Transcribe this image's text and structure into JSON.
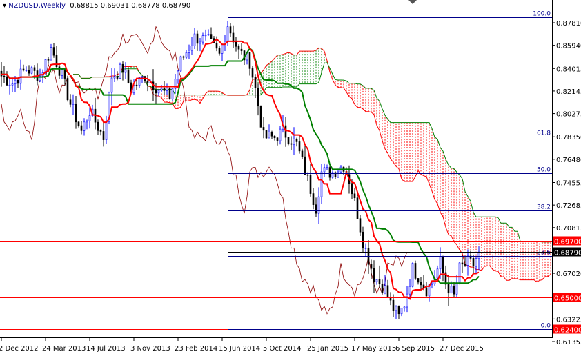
{
  "header": {
    "symbol": "NZDUSD,Weekly",
    "ohlc": "0.68815 0.69031 0.68778 0.68790"
  },
  "chart_data": {
    "type": "candlestick",
    "title": "NZDUSD,Weekly",
    "ylim": [
      0.6115,
      0.8925
    ],
    "y_ticks": [
      "0.87810",
      "0.85940",
      "0.84015",
      "0.82145",
      "0.80275",
      "0.78350",
      "0.76480",
      "0.74555",
      "0.72685",
      "0.70815",
      "0.67020",
      "0.63225",
      "0.61355"
    ],
    "x_ticks": [
      "2 Dec 2012",
      "24 Mar 2013",
      "14 Jul 2013",
      "3 Nov 2013",
      "23 Feb 2014",
      "15 Jun 2014",
      "5 Oct 2014",
      "25 Jan 2015",
      "17 May 2015",
      "6 Sep 2015",
      "27 Dec 2015"
    ],
    "x_tick_weeks": [
      0,
      16,
      32,
      48,
      64,
      80,
      96,
      112,
      128,
      144,
      160
    ],
    "close_keyframes": [
      [
        0,
        0.834
      ],
      [
        4,
        0.828
      ],
      [
        9,
        0.84
      ],
      [
        14,
        0.834
      ],
      [
        18,
        0.857
      ],
      [
        22,
        0.834
      ],
      [
        25,
        0.811
      ],
      [
        29,
        0.788
      ],
      [
        32,
        0.805
      ],
      [
        37,
        0.783
      ],
      [
        40,
        0.834
      ],
      [
        44,
        0.84
      ],
      [
        47,
        0.823
      ],
      [
        52,
        0.834
      ],
      [
        57,
        0.823
      ],
      [
        61,
        0.817
      ],
      [
        65,
        0.846
      ],
      [
        70,
        0.866
      ],
      [
        75,
        0.863
      ],
      [
        79,
        0.851
      ],
      [
        82,
        0.877
      ],
      [
        86,
        0.854
      ],
      [
        90,
        0.846
      ],
      [
        92,
        0.823
      ],
      [
        95,
        0.783
      ],
      [
        99,
        0.783
      ],
      [
        102,
        0.788
      ],
      [
        107,
        0.777
      ],
      [
        111,
        0.748
      ],
      [
        114,
        0.725
      ],
      [
        116,
        0.754
      ],
      [
        120,
        0.754
      ],
      [
        124,
        0.76
      ],
      [
        126,
        0.748
      ],
      [
        129,
        0.72
      ],
      [
        131,
        0.697
      ],
      [
        135,
        0.668
      ],
      [
        139,
        0.657
      ],
      [
        141,
        0.645
      ],
      [
        144,
        0.634
      ],
      [
        146,
        0.645
      ],
      [
        149,
        0.674
      ],
      [
        151,
        0.668
      ],
      [
        154,
        0.657
      ],
      [
        156,
        0.662
      ],
      [
        159,
        0.679
      ],
      [
        161,
        0.662
      ],
      [
        164,
        0.651
      ],
      [
        166,
        0.674
      ],
      [
        169,
        0.679
      ],
      [
        171,
        0.677
      ],
      [
        173,
        0.6879
      ]
    ],
    "fibonacci": [
      {
        "label": "100.0",
        "price": 0.8826
      },
      {
        "label": "61.8",
        "price": 0.7839
      },
      {
        "label": "50.0",
        "price": 0.7532
      },
      {
        "label": "38.2",
        "price": 0.7226
      },
      {
        "label": "23.6",
        "price": 0.6846
      },
      {
        "label": "0.0",
        "price": 0.624
      }
    ],
    "levels": [
      {
        "label": "0.69700",
        "price": 0.697,
        "color": "#ff0000"
      },
      {
        "label": "0.65000",
        "price": 0.65,
        "color": "#ff0000"
      },
      {
        "label": "0.62400",
        "price": 0.624,
        "color": "#ff0000"
      }
    ],
    "current_price": {
      "label": "0.68790",
      "price": 0.6879
    },
    "colors": {
      "bull": "#0000ff",
      "bear": "#000000",
      "tenkan": "#ff0000",
      "kijun": "#008000",
      "chikou": "#8b0000",
      "cloud_up": "#008000",
      "cloud_down": "#ff0000",
      "fibo": "#00008b"
    }
  }
}
